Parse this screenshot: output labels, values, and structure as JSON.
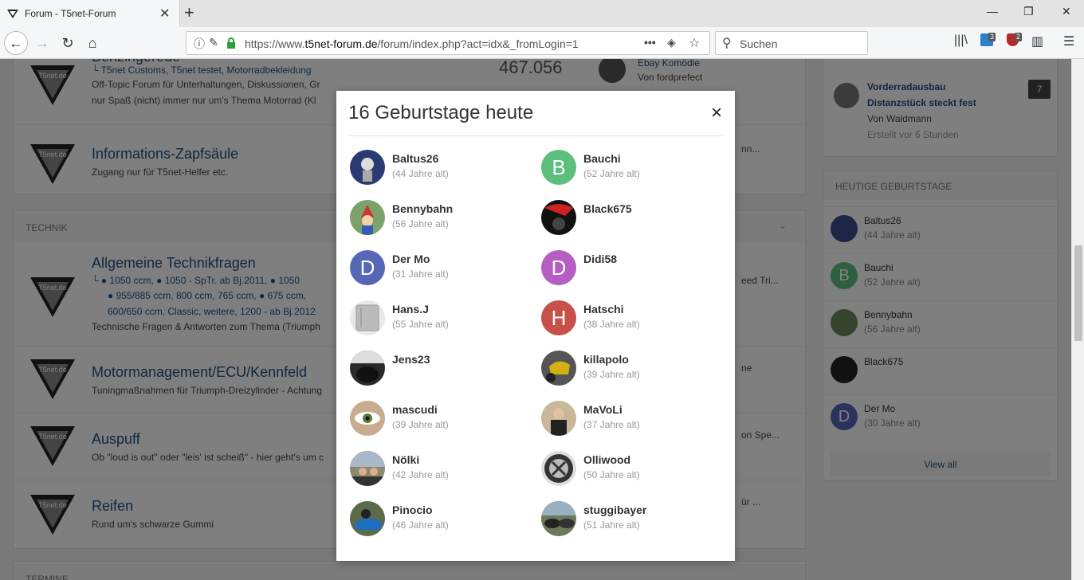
{
  "browser": {
    "tab_title": "Forum - T5net-Forum",
    "url_prefix": "https://www.",
    "url_domain": "t5net-forum.de",
    "url_path": "/forum/index.php?act=idx&_fromLogin=1",
    "search_placeholder": "Suchen",
    "ext_badge_1": "3",
    "ext_badge_2": "2"
  },
  "forums": [
    {
      "title": "Benzingerede",
      "links": "└ T5net Customs,   T5net testet,   Motorradbekleidung",
      "desc1": "Off-Topic Forum für Unterhaltungen, Diskussionen, Gr",
      "desc2": "nur Spaß (nicht) immer nur um's Thema Motorrad (Kl",
      "count": "467.056",
      "last_title": "Ebay Komödie",
      "last_by": "Von fordprefect"
    },
    {
      "title": "Informations-Zapfsäule",
      "desc1": "Zugang nur für T5net-Helfer etc.",
      "last_snip": "nn..."
    }
  ],
  "technik": {
    "header": "TECHNIK",
    "forums": [
      {
        "title": "Allgemeine Technikfragen",
        "links1": "└ ● 1050 ccm,  ● 1050 - SpTr. ab Bj.2011,  ● 1050",
        "links2": "● 955/885 ccm,   800 ccm,   765 ccm,  ● 675 ccm,",
        "links3": "600/650 ccm, Classic, weitere,   1200 - ab Bj.2012",
        "desc1": "Technische Fragen & Antworten zum Thema (Triumph",
        "last_snip": "eed Tri..."
      },
      {
        "title": "Motormanagement/ECU/Kennfeld",
        "desc1": "Tuningmaßnahmen für Triumph-Dreizylinder - Achtung",
        "last_snip": "ne"
      },
      {
        "title": "Auspuff",
        "desc1": "Ob \"loud is out\" oder \"leis' ist scheiß\" - hier geht's um c",
        "last_snip": "on Spe..."
      },
      {
        "title": "Reifen",
        "desc1": "Rund um's schwarze Gummi",
        "last_snip": "ür ..."
      }
    ],
    "next_header": "TERMINE"
  },
  "sidebar": {
    "topic": {
      "line1": "Vorderradausbau",
      "line2": "Distanzstück steckt fest",
      "by": "Von Waldmann",
      "time": "Erstellt vor 6 Stunden",
      "count": "7"
    },
    "birthdays_header": "HEUTIGE GEBURTSTAGE",
    "birthdays": [
      {
        "name": "Baltus26",
        "age": "(44 Jahre alt)"
      },
      {
        "name": "Bauchi",
        "age": "(52 Jahre alt)",
        "initial": "B"
      },
      {
        "name": "Bennybahn",
        "age": "(56 Jahre alt)"
      },
      {
        "name": "Black675",
        "age": ""
      },
      {
        "name": "Der Mo",
        "age": "(30 Jahre alt)",
        "initial": "D"
      }
    ],
    "view_all": "View all"
  },
  "modal": {
    "title": "16 Geburtstage heute",
    "close": "×",
    "people": [
      {
        "name": "Baltus26",
        "age": "(44 Jahre alt)",
        "initial": ""
      },
      {
        "name": "Bauchi",
        "age": "(52 Jahre alt)",
        "initial": "B"
      },
      {
        "name": "Bennybahn",
        "age": "(56 Jahre alt)",
        "initial": ""
      },
      {
        "name": "Black675",
        "age": "",
        "initial": ""
      },
      {
        "name": "Der Mo",
        "age": "(31 Jahre alt)",
        "initial": "D"
      },
      {
        "name": "Didi58",
        "age": "",
        "initial": "D"
      },
      {
        "name": "Hans.J",
        "age": "(55 Jahre alt)",
        "initial": ""
      },
      {
        "name": "Hatschi",
        "age": "(38 Jahre alt)",
        "initial": "H"
      },
      {
        "name": "Jens23",
        "age": "",
        "initial": ""
      },
      {
        "name": "killapolo",
        "age": "(39 Jahre alt)",
        "initial": ""
      },
      {
        "name": "mascudi",
        "age": "(39 Jahre alt)",
        "initial": ""
      },
      {
        "name": "MaVoLi",
        "age": "(37 Jahre alt)",
        "initial": ""
      },
      {
        "name": "Nölki",
        "age": "(42 Jahre alt)",
        "initial": ""
      },
      {
        "name": "Olliwood",
        "age": "(50 Jahre alt)",
        "initial": ""
      },
      {
        "name": "Pinocio",
        "age": "(46 Jahre alt)",
        "initial": ""
      },
      {
        "name": "stuggibayer",
        "age": "(51 Jahre alt)",
        "initial": ""
      }
    ]
  },
  "colors": {
    "accent": "#1f4f7f",
    "bauchi": "#5cbf7e",
    "dermo": "#5767b8",
    "didi": "#b55fc2",
    "hatschi": "#c8504b",
    "secure": "#2e9e3a"
  }
}
